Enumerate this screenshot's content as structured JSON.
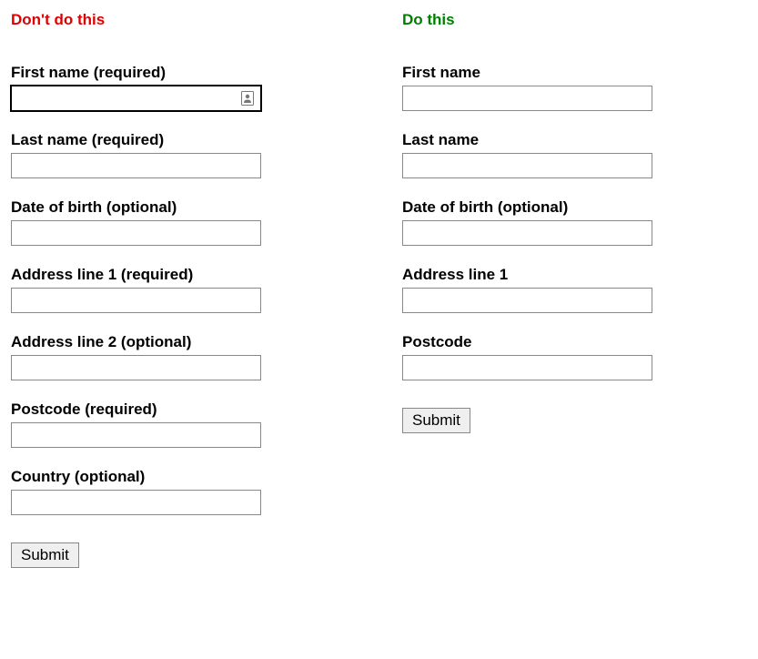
{
  "left": {
    "heading": "Don't do this",
    "fields": [
      {
        "label": "First name (required)"
      },
      {
        "label": "Last name (required)"
      },
      {
        "label": "Date of birth (optional)"
      },
      {
        "label": "Address line 1 (required)"
      },
      {
        "label": "Address line 2 (optional)"
      },
      {
        "label": "Postcode (required)"
      },
      {
        "label": "Country (optional)"
      }
    ],
    "submit": "Submit"
  },
  "right": {
    "heading": "Do this",
    "fields": [
      {
        "label": "First name"
      },
      {
        "label": "Last name"
      },
      {
        "label": "Date of birth (optional)"
      },
      {
        "label": "Address line 1"
      },
      {
        "label": "Postcode"
      }
    ],
    "submit": "Submit"
  }
}
